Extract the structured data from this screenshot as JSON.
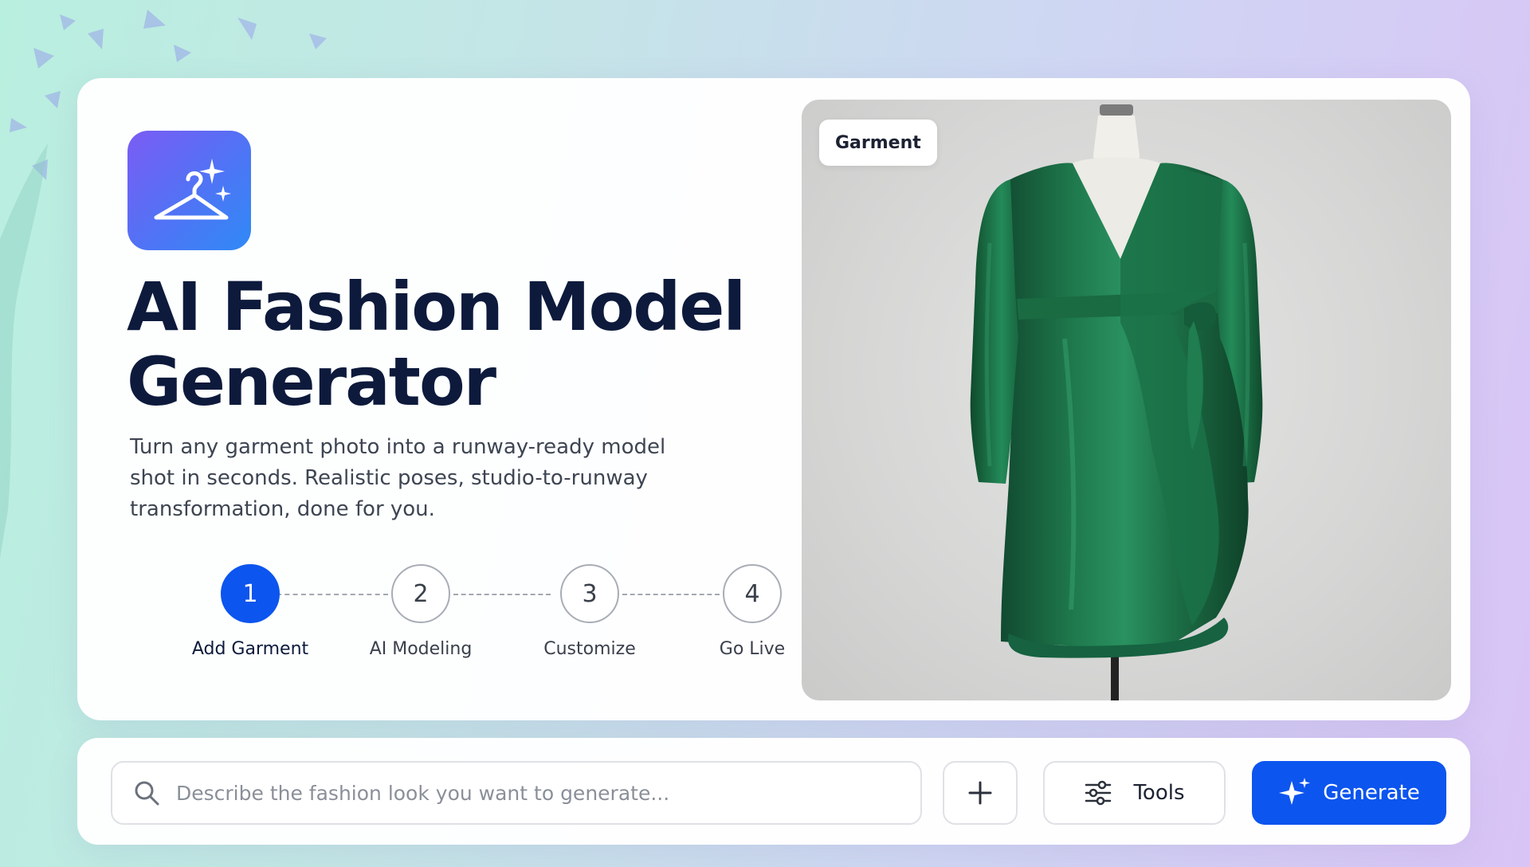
{
  "app": {
    "title": "AI Fashion Model Generator",
    "subtitle": "Turn any garment photo into a runway-ready model shot in seconds. Realistic poses, studio-to-runway transformation, done for you.",
    "icon": "hanger-sparkle-icon"
  },
  "steps": [
    {
      "number": "1",
      "label": "Add Garment",
      "active": true
    },
    {
      "number": "2",
      "label": "AI Modeling",
      "active": false
    },
    {
      "number": "3",
      "label": "Customize",
      "active": false
    },
    {
      "number": "4",
      "label": "Go Live",
      "active": false
    }
  ],
  "preview": {
    "badge": "Garment"
  },
  "prompt": {
    "placeholder": "Describe the fashion look you want to generate...",
    "value": "",
    "add_icon": "plus-icon",
    "tools_label": "Tools",
    "tools_icon": "sliders-icon",
    "generate_label": "Generate",
    "generate_icon": "sparkle-icon"
  },
  "colors": {
    "accent": "#0C55EE",
    "title": "#0D1A3C",
    "dress": "#1E6B45"
  }
}
